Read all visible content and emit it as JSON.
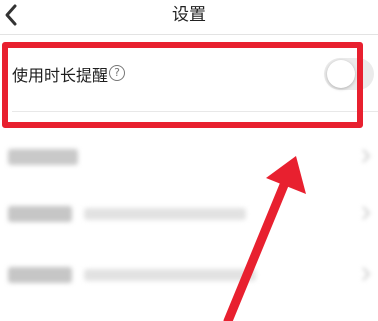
{
  "header": {
    "title": "设置",
    "back_icon": "chevron-left-icon"
  },
  "setting": {
    "label": "使用时长提醒",
    "help_glyph": "?",
    "toggle_state": "off"
  },
  "colors": {
    "annotation": "#e8202f",
    "toggle_off": "#ebebeb"
  }
}
